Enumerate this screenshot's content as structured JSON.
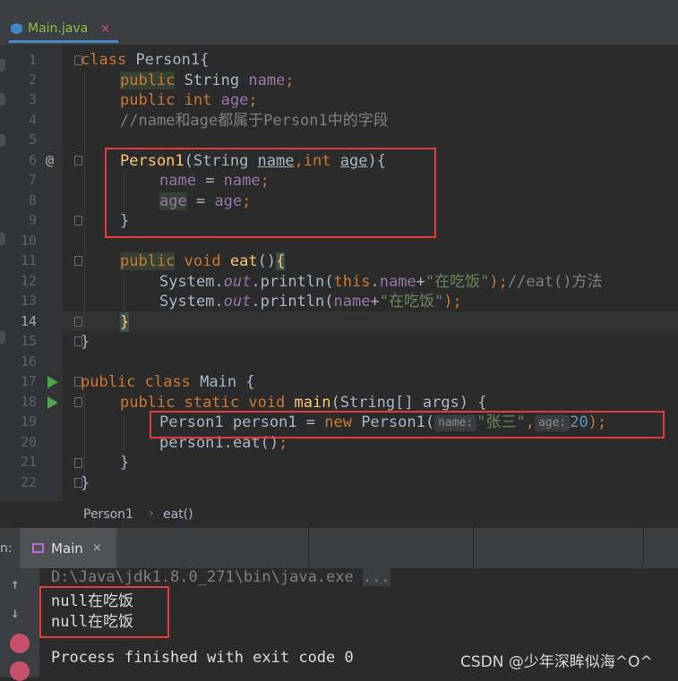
{
  "editor_tab": {
    "label": "Main.java",
    "close": "×",
    "icon": "java-class-icon"
  },
  "gutter": {
    "line_numbers": [
      "1",
      "2",
      "3",
      "4",
      "5",
      "6",
      "7",
      "8",
      "9",
      "10",
      "11",
      "12",
      "13",
      "14",
      "15",
      "16",
      "17",
      "18",
      "19",
      "20",
      "21",
      "22"
    ],
    "override_marker": "@"
  },
  "code": {
    "l1": [
      "class",
      "Person1{"
    ],
    "l2": [
      "public",
      "String",
      "name",
      ";"
    ],
    "l3": [
      "public",
      "int",
      "age",
      ";"
    ],
    "l4": "//name和age都属于Person1中的字段",
    "l6": [
      "Person1",
      "(String ",
      "name",
      ",",
      "int",
      " ",
      "age",
      "){"
    ],
    "l7": [
      "name",
      " = ",
      "name",
      ";"
    ],
    "l8": [
      "age",
      " = ",
      "age",
      ";"
    ],
    "l9": "}",
    "l11": [
      "public",
      "void",
      "eat",
      "()",
      "{"
    ],
    "l12": [
      "System.",
      "out",
      ".println(",
      "this",
      ".",
      "name",
      "+",
      "\"在吃饭\"",
      ");",
      "//eat()方法"
    ],
    "l13": [
      "System.",
      "out",
      ".println(",
      "name",
      "+",
      "\"在吃饭\"",
      ");"
    ],
    "l14": "}",
    "l15": "}",
    "l17": [
      "public",
      "class",
      "Main {"
    ],
    "l18": [
      "public",
      "static",
      "void",
      "main",
      "(String[] args) {"
    ],
    "l19": [
      "Person1 person1 = ",
      "new",
      " Person1(",
      "name:",
      "\"张三\"",
      ",",
      "age:",
      "20",
      ");"
    ],
    "l20": [
      "person1.eat()",
      ";"
    ],
    "l21": "}",
    "l22": "}"
  },
  "breadcrumb": {
    "class": "Person1",
    "separator": "›",
    "method": "eat()"
  },
  "run_panel": {
    "label": "n:",
    "tab_label": "Main",
    "tab_close": "×"
  },
  "console": {
    "command": "D:\\Java\\jdk1.8.0_271\\bin\\java.exe",
    "command_ellipsis": "...",
    "output": [
      "null在吃饭",
      "null在吃饭"
    ],
    "finished": "Process finished with exit code 0"
  },
  "watermark": "CSDN @少年深眸似海^O^",
  "colors": {
    "keyword": "#cc7832",
    "field": "#9876aa",
    "string": "#6a8759",
    "number": "#6897bb",
    "method": "#ffc66d",
    "annotation_box": "#e43c3c"
  }
}
